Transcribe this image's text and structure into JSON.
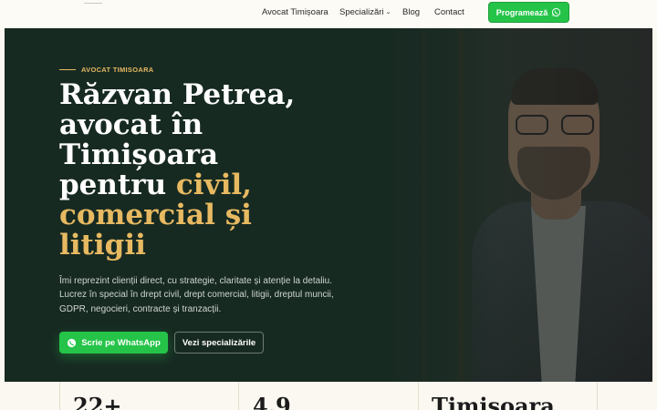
{
  "nav": {
    "links": [
      "Avocat Timișoara",
      "Specializări",
      "Blog",
      "Contact"
    ],
    "cta_label": "Programează"
  },
  "hero": {
    "eyebrow": "AVOCAT TIMISOARA",
    "headline_white_1": "Răzvan Petrea,",
    "headline_white_2": "avocat în",
    "headline_white_3": "Timișoara",
    "headline_white_4": "pentru ",
    "headline_gold_1": "civil,",
    "headline_gold_2": "comercial și",
    "headline_gold_3": "litigii",
    "lead": "Îmi reprezint clienții direct, cu strategie, claritate și atenție la detaliu. Lucrez în special în drept civil, drept comercial, litigii, dreptul muncii, GDPR, negocieri, contracte și tranzacții.",
    "btn_whatsapp": "Scrie pe WhatsApp",
    "btn_specializations": "Vezi specializările"
  },
  "stats": {
    "values": [
      "22+",
      "4.9",
      "Timișoara"
    ]
  },
  "colors": {
    "hero_bg": "#172a22",
    "accent_gold": "#e7b961",
    "whatsapp_green": "#25c449",
    "page_bg": "#fbf8f1"
  },
  "icons": {
    "whatsapp": "whatsapp-icon",
    "chevron": "chevron-down-icon"
  }
}
